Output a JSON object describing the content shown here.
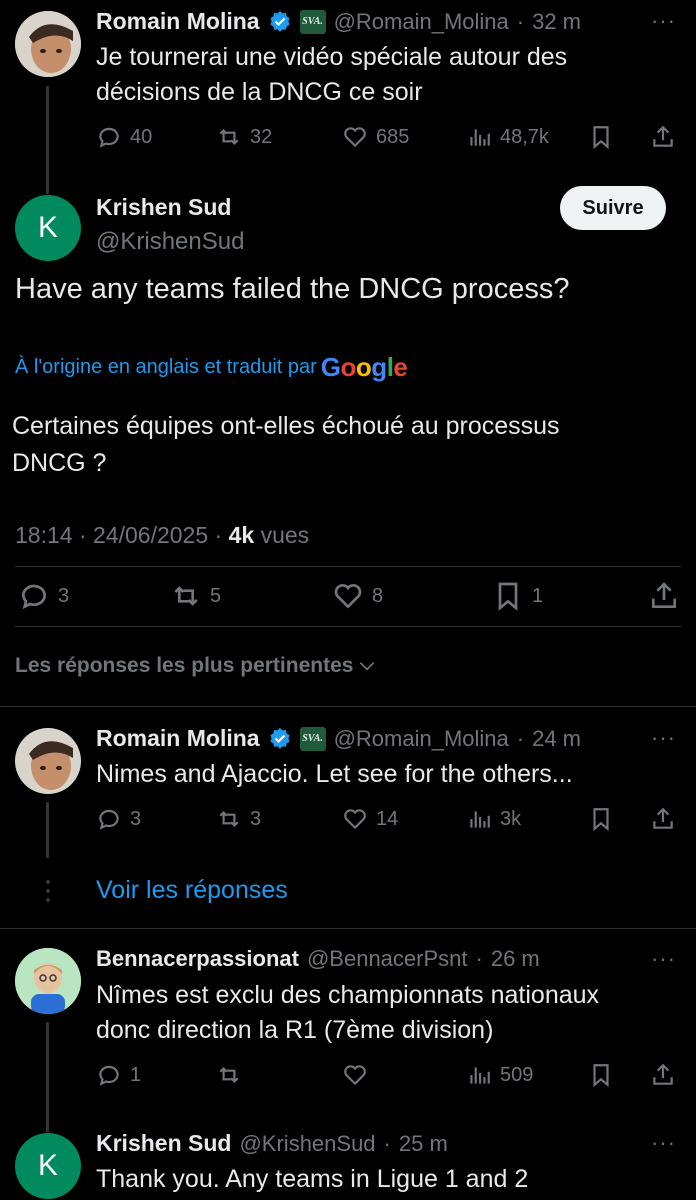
{
  "tweet1": {
    "name": "Romain Molina",
    "handle": "@Romain_Molina",
    "time": "32 m",
    "badge": "SVA.",
    "text_line1": "Je tournerai une vidéo spéciale autour des",
    "text_line2": "décisions de la DNCG ce soir",
    "replies": "40",
    "reposts": "32",
    "likes": "685",
    "views": "48,7k"
  },
  "main_tweet": {
    "name": "Krishen Sud",
    "handle": "@KrishenSud",
    "avatar_letter": "K",
    "follow_label": "Suivre",
    "text": "Have any teams failed the DNCG process?",
    "translation_prefix": "À l'origine en anglais et traduit par",
    "google_letters": [
      "G",
      "o",
      "o",
      "g",
      "l",
      "e"
    ],
    "translated_line1": "Certaines équipes ont-elles échoué au processus",
    "translated_line2": "DNCG ?",
    "time": "18:14",
    "date": "24/06/2025",
    "views_count": "4k",
    "views_label": "vues",
    "replies": "3",
    "reposts": "5",
    "likes": "8",
    "bookmarks": "1"
  },
  "sort": {
    "label": "Les réponses les plus pertinentes"
  },
  "reply1": {
    "name": "Romain Molina",
    "handle": "@Romain_Molina",
    "time": "24 m",
    "badge": "SVA.",
    "text": "Nimes and Ajaccio. Let see for the others...",
    "replies": "3",
    "reposts": "3",
    "likes": "14",
    "views": "3k",
    "see_replies": "Voir les réponses"
  },
  "reply2": {
    "name": "Bennacerpassionat",
    "handle": "@BennacerPsnt",
    "time": "26 m",
    "text_line1": "Nîmes est exclu des championnats nationaux",
    "text_line2": "donc direction la R1 (7ème division)",
    "replies": "1",
    "views": "509"
  },
  "reply3": {
    "name": "Krishen Sud",
    "handle": "@KrishenSud",
    "time": "25 m",
    "avatar_letter": "K",
    "text": "Thank you. Any teams in Ligue 1 and 2"
  },
  "separator": "·",
  "more": "···",
  "colors": {
    "background": "#000000",
    "text": "#e7e9ea",
    "muted": "#71767b",
    "link": "#1d9bf0",
    "verified": "#1d9bf0",
    "avatar_k": "#008a5e"
  }
}
